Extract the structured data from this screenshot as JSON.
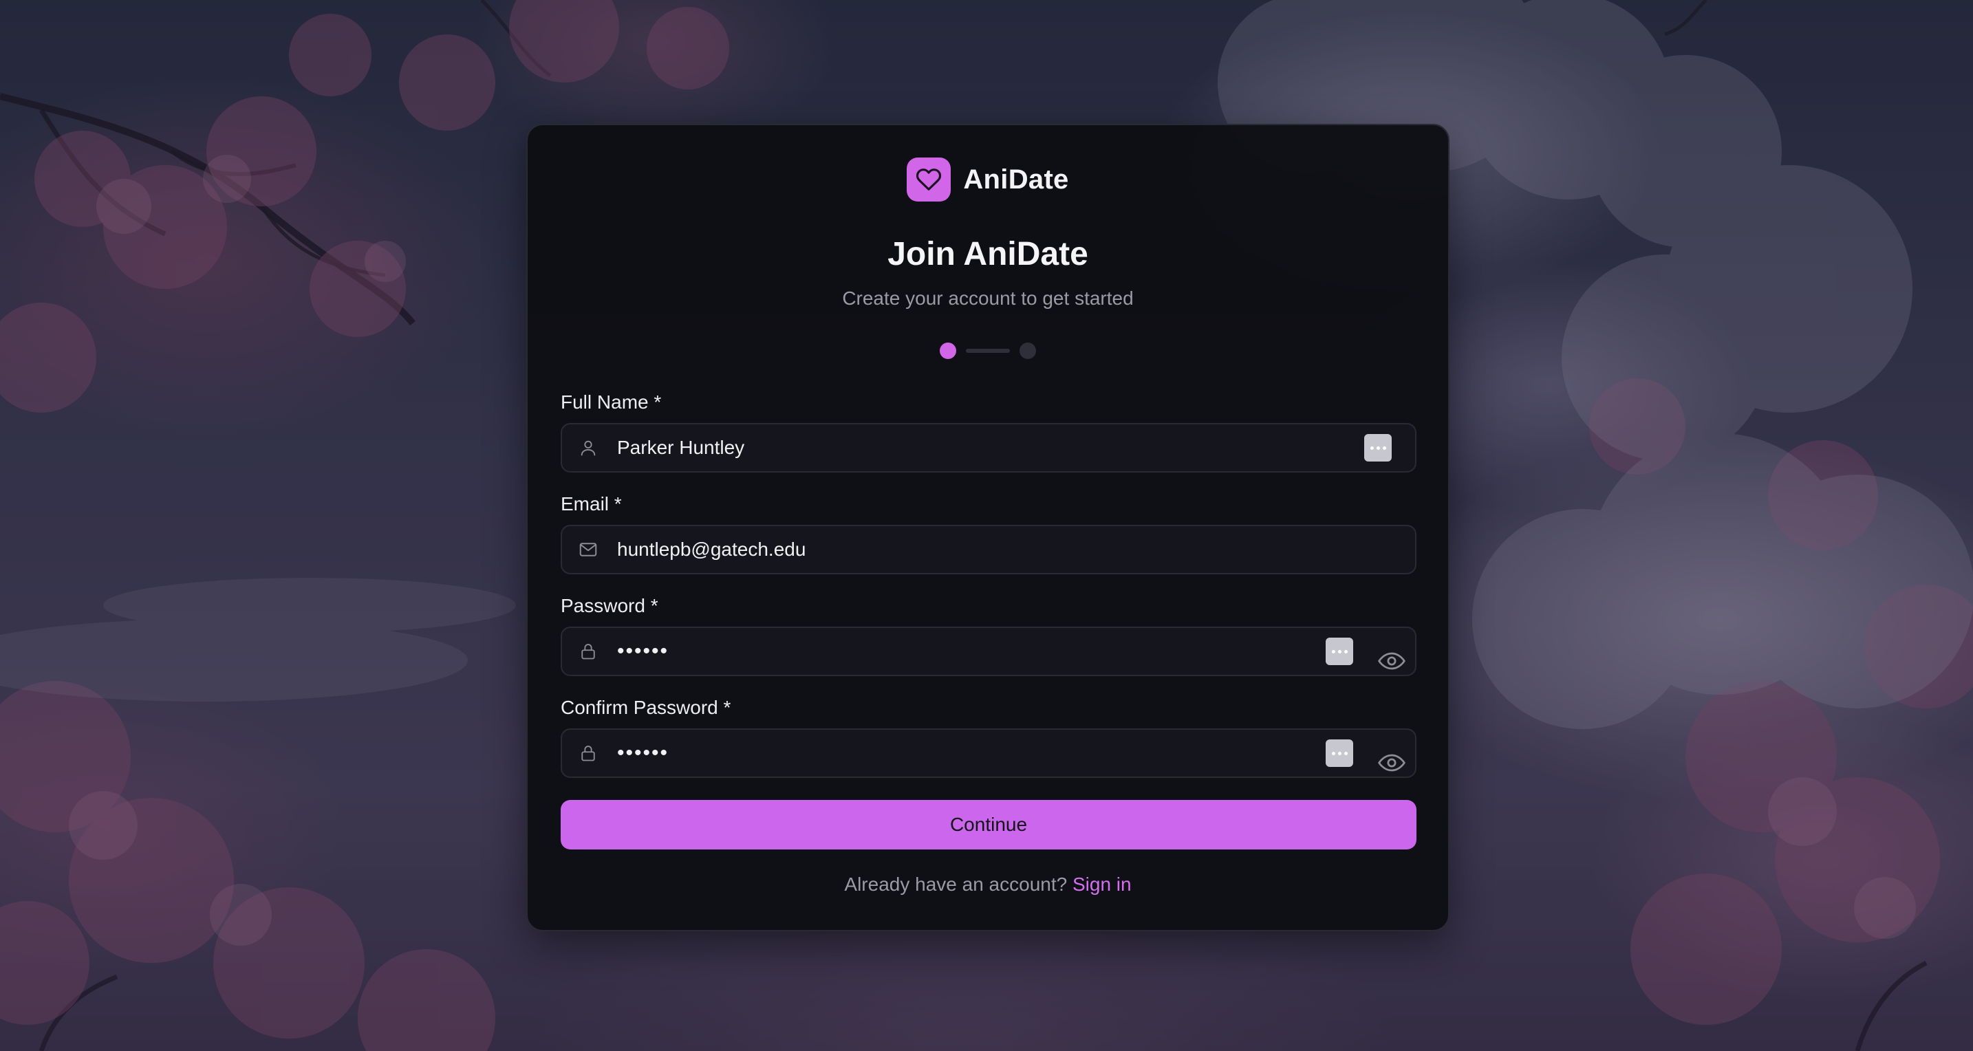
{
  "app": {
    "brand_name": "AniDate",
    "logo_icon": "heart-icon",
    "accent_color": "#cc66ec"
  },
  "header": {
    "title": "Join AniDate",
    "subtitle": "Create your account to get started"
  },
  "progress": {
    "current_step": 1,
    "total_steps": 2
  },
  "form": {
    "full_name": {
      "label": "Full Name *",
      "value": "Parker Huntley",
      "icon": "user-icon"
    },
    "email": {
      "label": "Email *",
      "value": "huntlepb@gatech.edu",
      "icon": "mail-icon"
    },
    "password": {
      "label": "Password *",
      "value": "••••••",
      "icon": "lock-icon"
    },
    "confirm_password": {
      "label": "Confirm Password *",
      "value": "••••••",
      "icon": "lock-icon"
    },
    "continue_label": "Continue"
  },
  "footer": {
    "prompt": "Already have an account?",
    "signin_label": "Sign in"
  }
}
